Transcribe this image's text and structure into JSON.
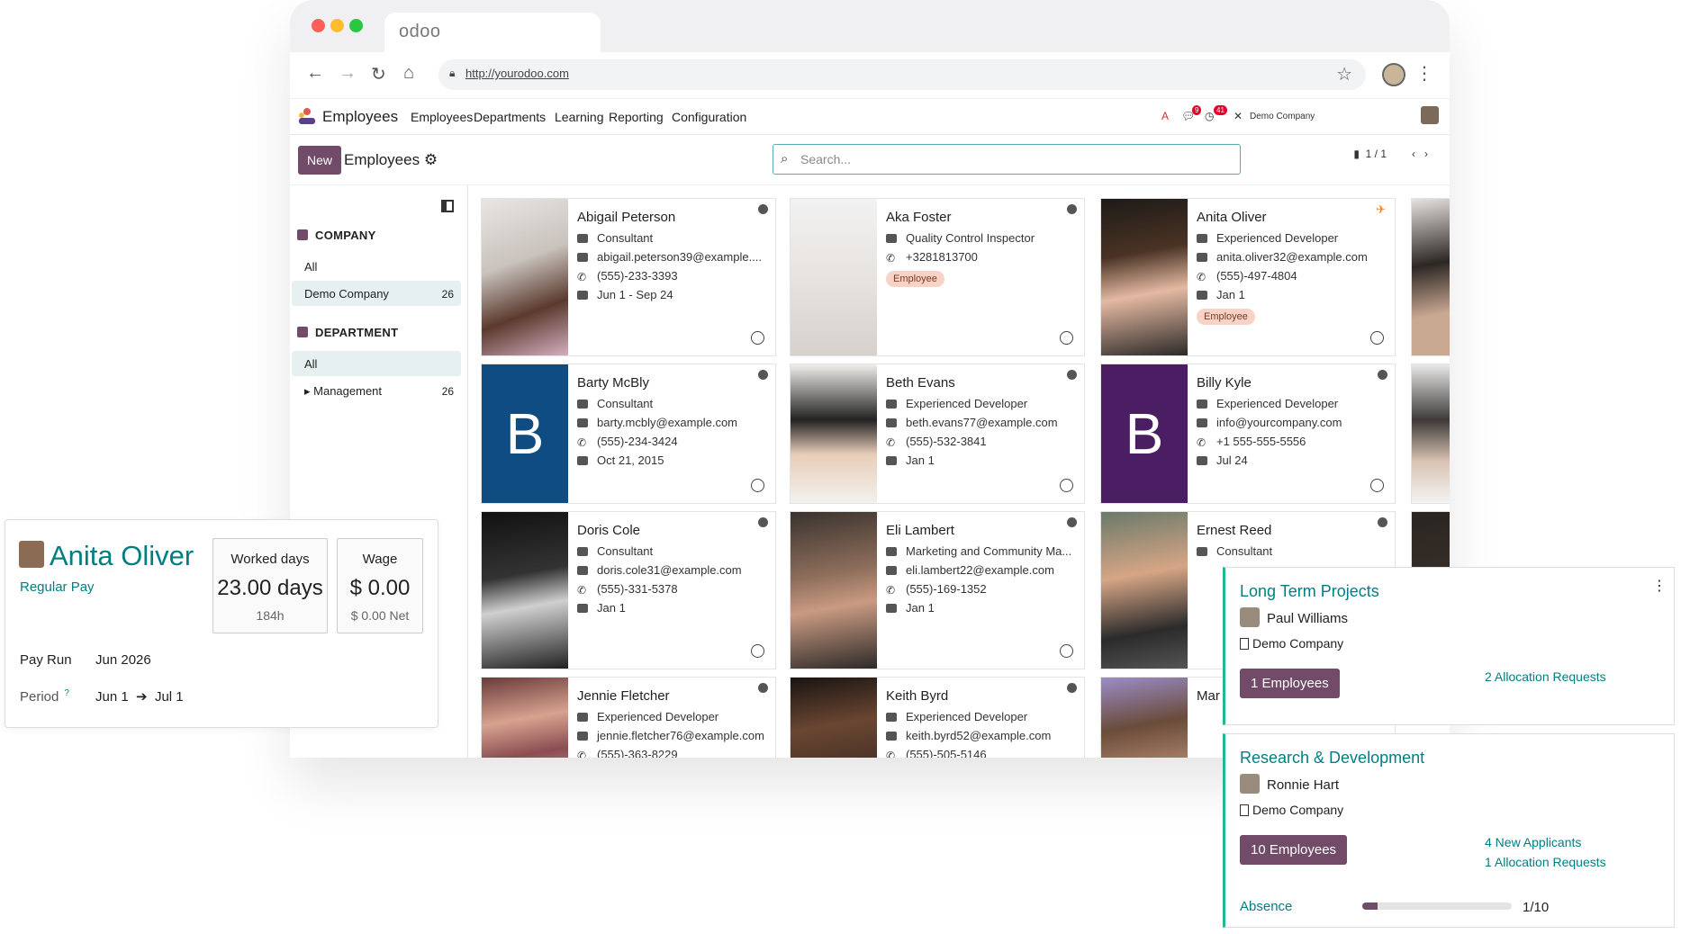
{
  "browser": {
    "tab_title": "odoo",
    "url": "http://yourodoo.com",
    "traffic_colors": [
      "#ff5f57",
      "#febc2e",
      "#28c840"
    ]
  },
  "navbar": {
    "app_name": "Employees",
    "menu": [
      "Employees",
      "Departments",
      "Learning",
      "Reporting",
      "Configuration"
    ],
    "badges": [
      "9",
      "41"
    ],
    "company": "Demo Company"
  },
  "control_panel": {
    "new_label": "New",
    "title": "Employees",
    "search_placeholder": "Search...",
    "pager": "1 / 1"
  },
  "sidebar": {
    "company_heading": "COMPANY",
    "company_items": [
      {
        "label": "All",
        "count": ""
      },
      {
        "label": "Demo Company",
        "count": "26"
      }
    ],
    "department_heading": "DEPARTMENT",
    "department_items": [
      {
        "label": "All",
        "count": ""
      },
      {
        "label": "Management",
        "count": "26"
      }
    ]
  },
  "employees": [
    {
      "name": "Abigail Peterson",
      "job": "Consultant",
      "email": "abigail.peterson39@example....",
      "phone": "(555)-233-3393",
      "date": "Jun 1 - Sep 24",
      "tag": ""
    },
    {
      "name": "Aka Foster",
      "job": "Quality Control Inspector",
      "email": "",
      "phone": "+3281813700",
      "date": "",
      "tag": "Employee"
    },
    {
      "name": "Anita Oliver",
      "job": "Experienced Developer",
      "email": "anita.oliver32@example.com",
      "phone": "(555)-497-4804",
      "date": "Jan 1",
      "tag": "Employee"
    },
    {
      "name": "Barty McBly",
      "job": "Consultant",
      "email": "barty.mcbly@example.com",
      "phone": "(555)-234-3424",
      "date": "Oct 21, 2015",
      "tag": "",
      "letter": "B",
      "color": "#0f4c81"
    },
    {
      "name": "Beth Evans",
      "job": "Experienced Developer",
      "email": "beth.evans77@example.com",
      "phone": "(555)-532-3841",
      "date": "Jan 1",
      "tag": ""
    },
    {
      "name": "Billy Kyle",
      "job": "Experienced Developer",
      "email": "info@yourcompany.com",
      "phone": "+1 555-555-5556",
      "date": "Jul 24",
      "tag": "",
      "letter": "B",
      "color": "#4b1d63"
    },
    {
      "name": "Doris Cole",
      "job": "Consultant",
      "email": "doris.cole31@example.com",
      "phone": "(555)-331-5378",
      "date": "Jan 1",
      "tag": ""
    },
    {
      "name": "Eli Lambert",
      "job": "Marketing and Community Ma...",
      "email": "eli.lambert22@example.com",
      "phone": "(555)-169-1352",
      "date": "Jan 1",
      "tag": ""
    },
    {
      "name": "Ernest Reed",
      "job": "Consultant",
      "email": "",
      "phone": "",
      "date": "",
      "tag": ""
    },
    {
      "name": "Jennie Fletcher",
      "job": "Experienced Developer",
      "email": "jennie.fletcher76@example.com",
      "phone": "(555)-363-8229",
      "date": "",
      "tag": ""
    },
    {
      "name": "Keith Byrd",
      "job": "Experienced Developer",
      "email": "keith.byrd52@example.com",
      "phone": "(555)-505-5146",
      "date": "",
      "tag": ""
    },
    {
      "name": "Mar",
      "job": "",
      "email": "",
      "phone": "",
      "date": "",
      "tag": ""
    }
  ],
  "payslip": {
    "employee": "Anita Oliver",
    "type": "Regular Pay",
    "worked_label": "Worked days",
    "worked_value": "23.00 days",
    "worked_hours": "184h",
    "wage_label": "Wage",
    "wage_value": "$ 0.00",
    "wage_net": "$ 0.00 Net",
    "pay_run_label": "Pay Run",
    "pay_run_value": "Jun 2026",
    "period_label": "Period",
    "period_help": "?",
    "period_from": "Jun 1",
    "period_to": "Jul 1"
  },
  "projects": [
    {
      "title": "Long Term Projects",
      "manager": "Paul Williams",
      "company": "Demo Company",
      "button": "1 Employees",
      "links": [
        "2 Allocation Requests"
      ]
    },
    {
      "title": "Research & Development",
      "manager": "Ronnie Hart",
      "company": "Demo Company",
      "button": "10 Employees",
      "links": [
        "4 New Applicants",
        "1 Allocation Requests"
      ],
      "absence_label": "Absence",
      "absence_value": "1/10",
      "absence_fraction": 0.1
    }
  ],
  "colors": {
    "primary": "#714b67",
    "teal": "#017e84",
    "tag_bg": "#f6d3c6"
  }
}
